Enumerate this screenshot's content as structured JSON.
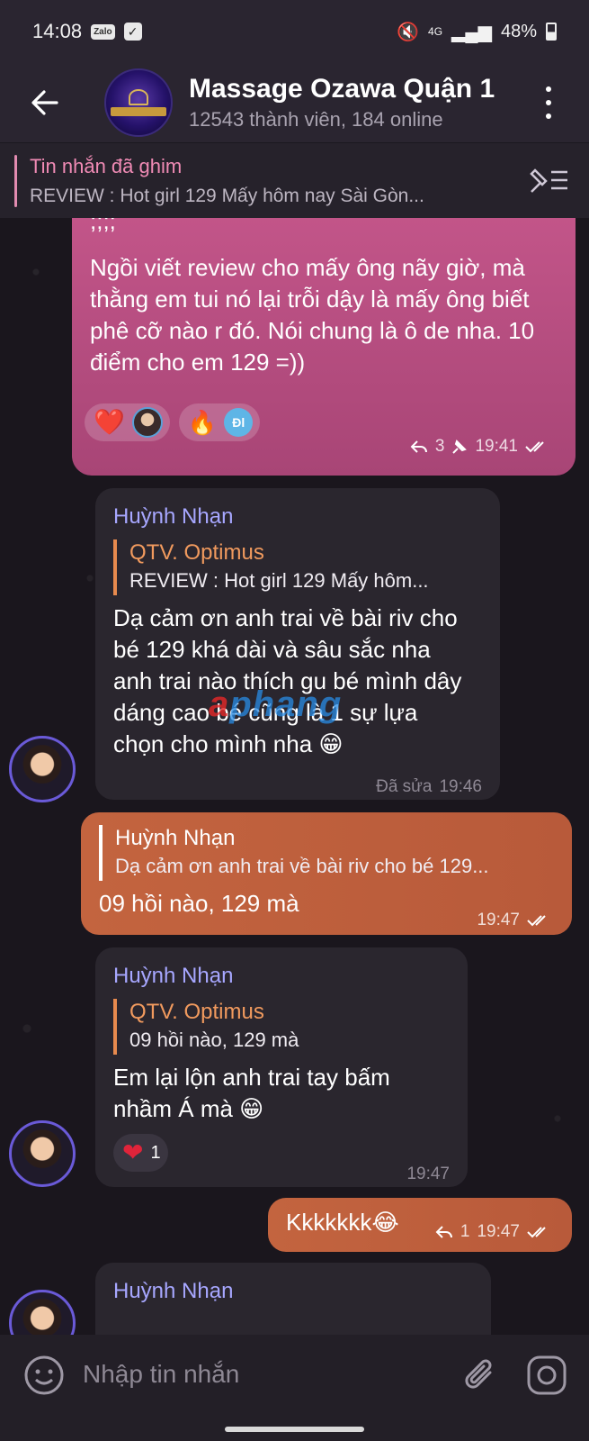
{
  "status": {
    "time": "14:08",
    "zalo_badge": "Zalo",
    "network": "4G",
    "battery": "48%"
  },
  "header": {
    "title": "Massage Ozawa Quận 1",
    "subtitle": "12543 thành viên, 184 online"
  },
  "pinned": {
    "title": "Tin nhắn đã ghim",
    "preview": "REVIEW : Hot girl 129  Mấy hôm nay Sài Gòn..."
  },
  "messages": [
    {
      "text_tail": ";;;;",
      "text": "Ngồi viết review cho mấy ông nãy giờ, mà thằng em tui nó lại trỗi dậy là mấy ông biết phê cỡ nào r đó. Nói chung là ô de nha. 10 điểm cho em 129 =))",
      "reactions": [
        "❤️",
        "🔥"
      ],
      "reaction_user": "Đl",
      "replies": "3",
      "time": "19:41"
    },
    {
      "sender": "Huỳnh Nhạn",
      "reply_name": "QTV. Optimus",
      "reply_text": "REVIEW : Hot girl 129  Mấy hôm...",
      "text": "Dạ cảm ơn anh trai về bài riv cho bé 129 khá dài và sâu sắc nha anh trai nào thích gu bé mình dây dáng cao bé cũng là 1 sự lựa chọn cho mình nha 😁",
      "edited": "Đã sửa",
      "time": "19:46"
    },
    {
      "reply_name": "Huỳnh Nhạn",
      "reply_text": "Dạ cảm ơn anh trai về bài riv cho bé 129...",
      "text": "09 hồi nào, 129 mà",
      "time": "19:47"
    },
    {
      "sender": "Huỳnh Nhạn",
      "reply_name": "QTV. Optimus",
      "reply_text": "09 hồi nào, 129 mà",
      "text": "Em lại lộn anh trai tay bấm nhầm Á mà 😁",
      "reaction_count": "1",
      "time": "19:47"
    },
    {
      "text": "Kkkkkkk😂",
      "replies": "1",
      "time": "19:47"
    },
    {
      "sender": "Huỳnh Nhạn"
    }
  ],
  "watermark": {
    "a": "a",
    "rest": "phang"
  },
  "input": {
    "placeholder": "Nhập tin nhắn"
  },
  "icons": [
    "back-arrow-icon",
    "more-vert-icon",
    "pin-list-icon",
    "emoji-icon",
    "attach-icon",
    "camera-icon",
    "reply-arrow-icon",
    "pin-icon",
    "double-check-icon"
  ]
}
